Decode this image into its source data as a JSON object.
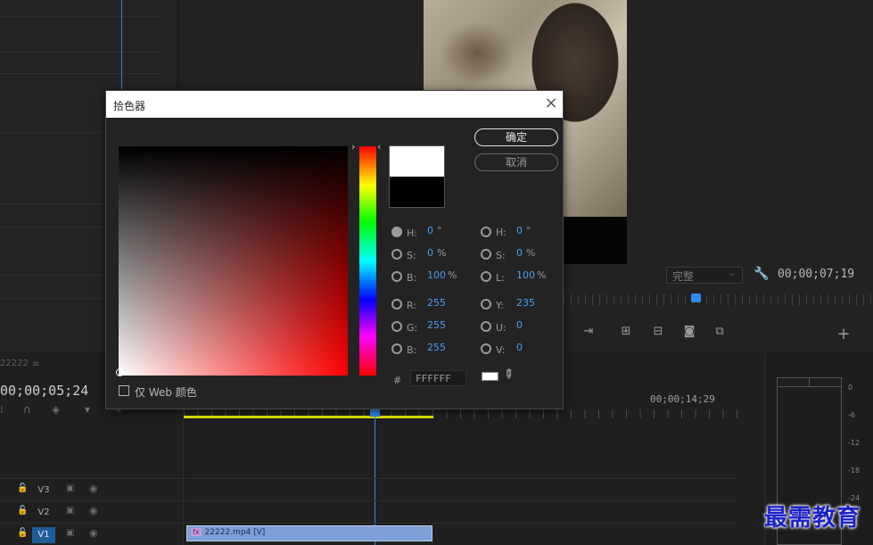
{
  "program_monitor": {
    "fit_value": "完整",
    "timecode": "00;00;07;19"
  },
  "sequence": {
    "name": "22222",
    "menu_glyph": "≡",
    "timecode": "00;00;05;24",
    "ruler_timecode": "00;00;14;29",
    "tracks": [
      {
        "name": "V3"
      },
      {
        "name": "V2"
      },
      {
        "name": "V1"
      }
    ],
    "clip": {
      "fx": "fx",
      "label": "22222.mp4 [V]"
    }
  },
  "meters": {
    "labels": [
      "0",
      "-6",
      "-12",
      "-18",
      "-24"
    ]
  },
  "watermark": "最需教育",
  "dialog": {
    "title": "拾色器",
    "ok_label": "确定",
    "cancel_label": "取消",
    "web_only_label": "仅 Web 颜色",
    "hsb": {
      "h": {
        "label": "H:",
        "value": "0",
        "unit": "°"
      },
      "s": {
        "label": "S:",
        "value": "0",
        "unit": "%"
      },
      "b": {
        "label": "B:",
        "value": "100",
        "unit": "%"
      }
    },
    "rgb": {
      "r": {
        "label": "R:",
        "value": "255"
      },
      "g": {
        "label": "G:",
        "value": "255"
      },
      "b": {
        "label": "B:",
        "value": "255"
      }
    },
    "hsl": {
      "h": {
        "label": "H:",
        "value": "0",
        "unit": "°"
      },
      "s": {
        "label": "S:",
        "value": "0",
        "unit": "%"
      },
      "l": {
        "label": "L:",
        "value": "100",
        "unit": "%"
      }
    },
    "yuv": {
      "y": {
        "label": "Y:",
        "value": "235"
      },
      "u": {
        "label": "U:",
        "value": "0"
      },
      "v": {
        "label": "V:",
        "value": "0"
      }
    },
    "hex_hash": "#",
    "hex_value": "FFFFFF",
    "new_color": "#ffffff",
    "old_color": "#000000"
  },
  "colors": {
    "accent": "#2d8ceb",
    "value_blue": "#4a9ff0",
    "work_area": "#e6e600",
    "clip": "#7d9fd8"
  }
}
